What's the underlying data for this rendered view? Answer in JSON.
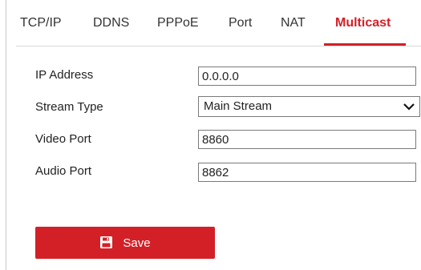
{
  "tabs": [
    {
      "label": "TCP/IP"
    },
    {
      "label": "DDNS"
    },
    {
      "label": "PPPoE"
    },
    {
      "label": "Port"
    },
    {
      "label": "NAT"
    },
    {
      "label": "Multicast"
    }
  ],
  "active_tab": "Multicast",
  "form": {
    "ip_address": {
      "label": "IP Address",
      "value": "0.0.0.0"
    },
    "stream_type": {
      "label": "Stream Type",
      "value": "Main Stream"
    },
    "video_port": {
      "label": "Video Port",
      "value": "8860"
    },
    "audio_port": {
      "label": "Audio Port",
      "value": "8862"
    }
  },
  "save_button": {
    "label": "Save",
    "icon": "save-icon"
  },
  "colors": {
    "accent": "#d32027",
    "border": "#7a7a7a"
  }
}
